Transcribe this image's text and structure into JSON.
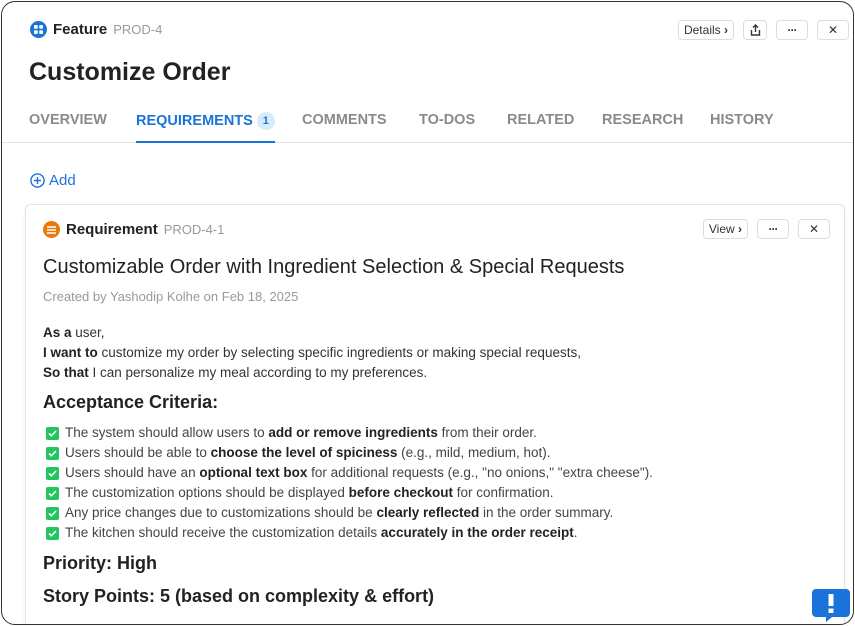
{
  "header": {
    "type": "Feature",
    "key": "PROD-4",
    "icon": "feature-grid-icon",
    "details_label": "Details",
    "title": "Customize Order"
  },
  "tabs": [
    {
      "label": "OVERVIEW"
    },
    {
      "label": "REQUIREMENTS",
      "badge": "1",
      "active": true
    },
    {
      "label": "COMMENTS"
    },
    {
      "label": "TO-DOS"
    },
    {
      "label": "RELATED"
    },
    {
      "label": "RESEARCH"
    },
    {
      "label": "HISTORY"
    }
  ],
  "add_label": "Add",
  "requirement": {
    "type": "Requirement",
    "key": "PROD-4-1",
    "icon": "requirement-list-icon",
    "view_label": "View",
    "title": "Customizable Order with Ingredient Selection & Special Requests",
    "meta": "Created by Yashodip Kolhe on Feb 18, 2025",
    "story": [
      {
        "bold": "As a",
        "text": " user,"
      },
      {
        "bold": "I want to",
        "text": " customize my order by selecting specific ingredients or making special requests,"
      },
      {
        "bold": "So that",
        "text": " I can personalize my meal according to my preferences."
      }
    ],
    "criteria_heading": "Acceptance Criteria:",
    "criteria": [
      {
        "pre": "The system should allow users to ",
        "bold": "add or remove ingredients",
        "post": " from their order."
      },
      {
        "pre": "Users should be able to ",
        "bold": "choose the level of spiciness",
        "post": " (e.g., mild, medium, hot)."
      },
      {
        "pre": "Users should have an ",
        "bold": "optional text box",
        "post": " for additional requests (e.g., \"no onions,\" \"extra cheese\")."
      },
      {
        "pre": "The customization options should be displayed ",
        "bold": "before checkout",
        "post": " for confirmation."
      },
      {
        "pre": "Any price changes due to customizations should be ",
        "bold": "clearly reflected",
        "post": " in the order summary."
      },
      {
        "pre": "The kitchen should receive the customization details ",
        "bold": "accurately in the order receipt",
        "post": "."
      }
    ],
    "priority": "Priority: High",
    "story_points": "Story Points: 5 (based on complexity & effort)"
  },
  "colors": {
    "accent": "#1a73d9",
    "requirement": "#e8790f",
    "check": "#22c55e"
  }
}
